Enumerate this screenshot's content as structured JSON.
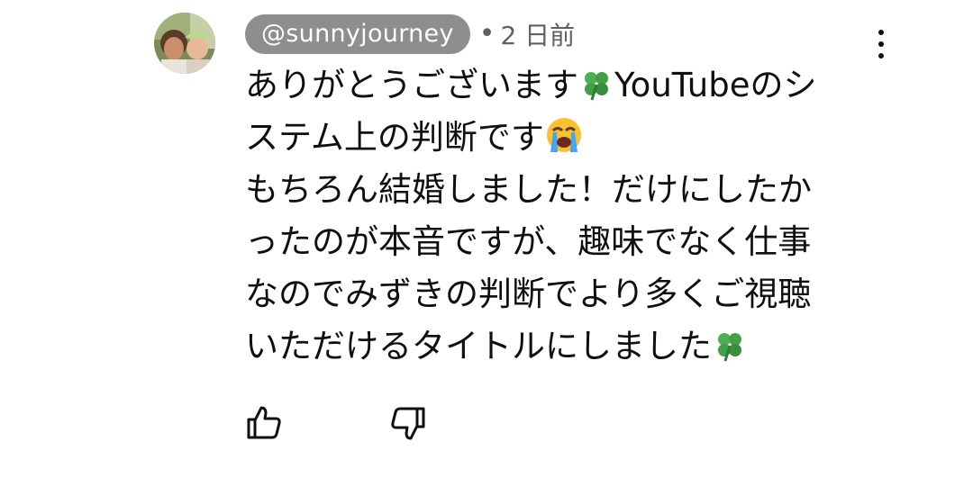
{
  "comment": {
    "author_handle": "@sunnyjourney",
    "separator": "•",
    "timestamp": "2 日前",
    "text_lines": [
      {
        "before": "ありがとうございます",
        "emoji": "four-leaf-clover",
        "after": "YouTubeのシ"
      },
      {
        "before": "ステム上の判断です",
        "emoji": "loudly-crying-face",
        "after": ""
      },
      {
        "before": "もちろん結婚しました！だけにしたか",
        "emoji": "",
        "after": ""
      },
      {
        "before": "ったのが本音ですが、趣味でなく仕事",
        "emoji": "",
        "after": ""
      },
      {
        "before": "なのでみずきの判断でより多くご視聴",
        "emoji": "",
        "after": ""
      },
      {
        "before": "いただけるタイトルにしました",
        "emoji": "four-leaf-clover",
        "after": ""
      }
    ]
  },
  "actions": {
    "like_icon": "thumbs-up-icon",
    "dislike_icon": "thumbs-down-icon",
    "more_icon": "more-vertical-icon"
  },
  "colors": {
    "text": "#0f0f0f",
    "secondary_text": "#606060",
    "handle_pill_bg": "#8e8e8e",
    "handle_pill_text": "#ffffff",
    "background": "#ffffff"
  }
}
